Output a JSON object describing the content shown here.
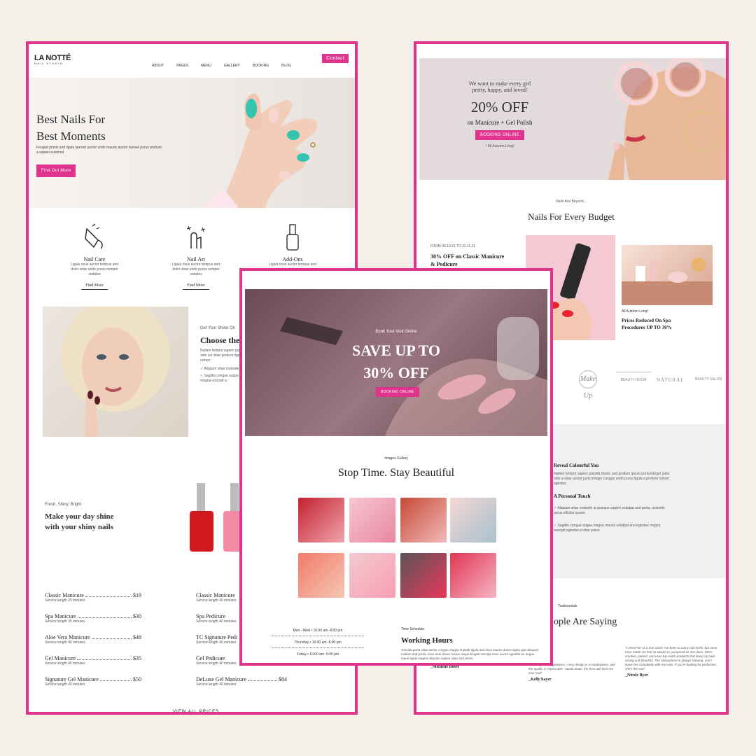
{
  "colors": {
    "accent": "#e0338e",
    "background": "#f5efe9"
  },
  "left": {
    "logo": "LA NOTTÉ",
    "logo_sub": "NAIL STUDIO",
    "nav": [
      "ABOUT",
      "PAGES",
      "MENU",
      "GALLERY",
      "BOOKING",
      "BLOG"
    ],
    "contact": "Contact",
    "hero_title_1": "Best Nails For",
    "hero_title_2": "Best Moments",
    "hero_text": "Feugiat primis and ligula laoreet auctor undo mauris auctor laoreet purus pretium a sapien euismod",
    "hero_button": "Find Out More",
    "services": [
      {
        "title": "Nail Care",
        "text": "Ligula risus auctor tempus and dolor vitae undo purus semper sodales",
        "link": "Find More"
      },
      {
        "title": "Nail Art",
        "text": "Ligula risus auctor tempus and dolor vitae undo purus semper sodales",
        "link": "Find More"
      },
      {
        "title": "Add-Ons",
        "text": "Ligula risus auctor tempus and dolor",
        "link": "Find More"
      }
    ],
    "shine_kicker": "Get Your Shine On",
    "shine_title": "Choose the",
    "shine_text": "Nullam tempor sapien justo an odio vel vitae pretium ligula rutrum",
    "shine_bullets": [
      "Aliquam vitae molestie",
      "Sagittis congue augue magna-suscipit a"
    ],
    "fresh_kicker": "Fresh, Shiny, Bright",
    "fresh_title_1": "Make your day shine",
    "fresh_title_2": "with your shiny nails",
    "prices_left": [
      {
        "name": "Classic Manicure",
        "price": "$19",
        "note": "Service length 25 minutes"
      },
      {
        "name": "Spa Manicure",
        "price": "$30",
        "note": "Service length 35 minutes"
      },
      {
        "name": "Aloe Vera Manicure",
        "price": "$48",
        "note": "Service length 40 minutes"
      },
      {
        "name": "Gel Manicure",
        "price": "$35",
        "note": "Service length 40 minutes"
      },
      {
        "name": "Signature Gel Manicure",
        "price": "$50",
        "note": "Service length 40 minutes"
      }
    ],
    "prices_right": [
      {
        "name": "Classic Manicure",
        "note": "Service length 40 minutes"
      },
      {
        "name": "Spa Pedicure",
        "note": "Service length 40 minutes"
      },
      {
        "name": "TC Signature Pedi",
        "note": "Service length 40 minutes"
      },
      {
        "name": "Gel Pedicure",
        "note": "Service length 40 minutes"
      },
      {
        "name": "DeLuxe Gel Manicure",
        "price": "$84",
        "note": "Service length 40 minutes"
      }
    ],
    "view_all": "VIEW ALL PRICES"
  },
  "right": {
    "promo_kicker_1": "We want to make every girl",
    "promo_kicker_2": "pretty, happy, and loved!",
    "promo_big": "20% OFF",
    "promo_sub": "on Manicure + Gel Polish",
    "promo_button": "BOOKING ONLINE",
    "promo_note": "* All Autumn Long!",
    "budget_kicker": "Nails And Beyond...",
    "budget_title": "Nails For Every Budget",
    "offer_date": "FROM 09.10.21 TO 22.11.21",
    "offer_title_1": "30% OFF on Classic Manicure",
    "offer_title_2": "& Pedicure",
    "card_kicker": "All Autumn Long!",
    "card_title_1": "Prices Reduced On Spa",
    "card_title_2": "Procedures UP TO 30%",
    "brands": [
      "Make Up",
      "BEAUTY ROOM",
      "NATURAL",
      "BEAUTY SALON"
    ],
    "reveal_title": "Reveal Colourful You",
    "reveal_text": "Nullam tempor sapien gravida donec and pretium ipsum porta integer justo odio a vitae auctor justo integer congue undo purus ligula a pretium rutrum egestas",
    "personal_touch": "A Personal Touch",
    "reveal_bullets": [
      "Aliquam vitae molestie at quisque sapien volutpat and porta, molestie purus efficitur ipsum",
      "Sagittis congue augue magna mauris volutpat and egestas magna suscipit egestas a vitae purus"
    ],
    "testimonials_kicker": "Testimonials",
    "testimonials_title": "ople Are Saying",
    "reviews": [
      {
        "text": "...getting my nails done by Nail Tech ...tention to detail is unmatched and she ...relaxing feeling pampered and ...the time to listen to what I want and ...my nail, highly recommend her for anyone looking for a professional top-tier nail experience!",
        "author": "_Michelle Boser"
      },
      {
        "text": "...offers great suggestions. I very design is a masterpiece, and the quality is impeccable. Hands down, the best nail tech I've ever had!",
        "author": "_Kelly bayer"
      },
      {
        "text": "\"LANOTTE\" is a true oasis! I've been to many nail techs, but none have made me feel as valued or pampered as she does. She's creative, patient, and uses top-notch products that keep my nails strong and beautiful. The atmosphere is always relaxing, and I leave her completely with my nails. If you're looking for perfection, she's the one!",
        "author": "_Nicole Byer"
      }
    ]
  },
  "middle": {
    "hero_kicker": "Book Your Visit Online",
    "hero_title_1": "SAVE UP TO",
    "hero_title_2": "30% OFF",
    "hero_button": "BOOKING ONLINE",
    "gallery_kicker": "Images Gallery",
    "gallery_title": "Stop Time. Stay Beautiful",
    "hours": [
      "Mon - Wed • 10:00 am -8:00 pm",
      "Thursday • 10:00 am -8:00 pm",
      "Friday • 10:00 am -9:00 pm"
    ],
    "schedule_kicker": "Time Schedule",
    "schedule_title": "Working Hours",
    "schedule_text": "Gravida porta vitae auctor congue magna impedit ligula and risus mauris donec ligula quis aliquam mollam and primis risus ante donec luctus neque feugiat suscipit risus auctor egestas an augue mauri ligula magnis aliquam sapien vitae and donec"
  }
}
